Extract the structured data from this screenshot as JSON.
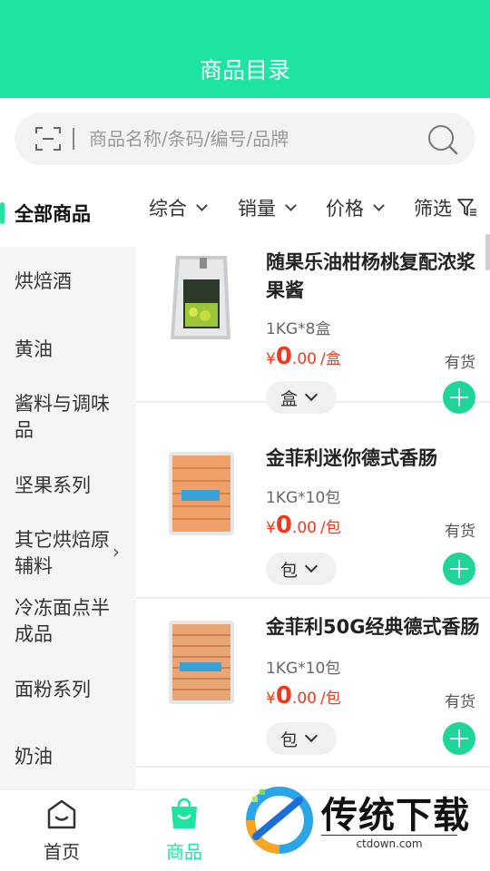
{
  "header": {
    "title": "商品目录"
  },
  "search": {
    "placeholder": "商品名称/条码/编号/品牌"
  },
  "sidebar": {
    "items": [
      {
        "label": "全部商品",
        "active": true
      },
      {
        "label": "烘焙酒"
      },
      {
        "label": "黄油"
      },
      {
        "label": "酱料与调味品"
      },
      {
        "label": "坚果系列"
      },
      {
        "label": "其它烘焙原辅料",
        "has_children": true
      },
      {
        "label": "冷冻面点半成品"
      },
      {
        "label": "面粉系列"
      },
      {
        "label": "奶油"
      }
    ]
  },
  "filters": [
    {
      "label": "综合"
    },
    {
      "label": "销量"
    },
    {
      "label": "价格"
    },
    {
      "label": "筛选"
    }
  ],
  "products": [
    {
      "name": "随果乐油柑杨桃复配浓浆果酱",
      "spec": "1KG*8盒",
      "currency": "¥",
      "price_int": "0",
      "price_dec": ".00",
      "unit_suffix": "/盒",
      "stock": "有货",
      "unit": "盒"
    },
    {
      "name": "金菲利迷你德式香肠",
      "spec": "1KG*10包",
      "currency": "¥",
      "price_int": "0",
      "price_dec": ".00",
      "unit_suffix": "/包",
      "stock": "有货",
      "unit": "包"
    },
    {
      "name": "金菲利50G经典德式香肠",
      "spec": "1KG*10包",
      "currency": "¥",
      "price_int": "0",
      "price_dec": ".00",
      "unit_suffix": "/包",
      "stock": "有货",
      "unit": "包"
    }
  ],
  "tabbar": {
    "items": [
      {
        "label": "首页",
        "icon": "home-icon"
      },
      {
        "label": "商品",
        "icon": "shopping-bag-icon",
        "active": true
      }
    ]
  },
  "watermark": {
    "title": "传统下载",
    "url": "ctdown.com"
  },
  "colors": {
    "accent": "#1de4a1",
    "price": "#f0391d"
  }
}
